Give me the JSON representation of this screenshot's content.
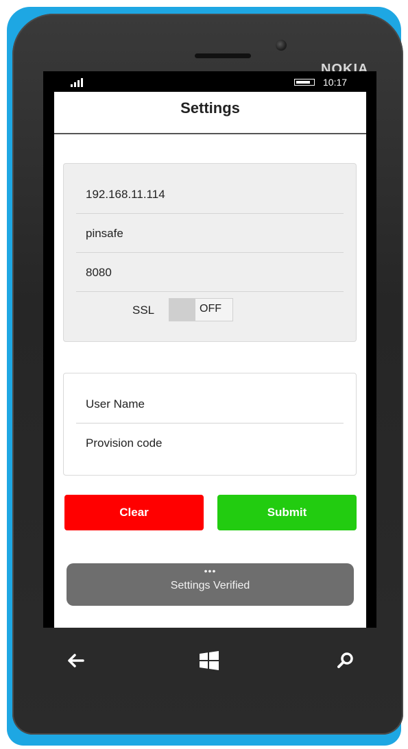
{
  "device": {
    "brand": "NOKIA"
  },
  "status_bar": {
    "time": "10:17",
    "signal_icon": "signal-bars-icon",
    "battery_icon": "battery-icon"
  },
  "header": {
    "title": "Settings"
  },
  "server_settings": {
    "host": "192.168.11.114",
    "site": "pinsafe",
    "port": "8080",
    "ssl_label": "SSL",
    "ssl_state": "OFF"
  },
  "credentials": {
    "username_placeholder": "User Name",
    "provision_placeholder": "Provision code"
  },
  "actions": {
    "clear_label": "Clear",
    "submit_label": "Submit"
  },
  "toast": {
    "dots": "•••",
    "message": "Settings Verified"
  },
  "nav": {
    "back_icon": "back-arrow-icon",
    "home_icon": "windows-start-icon",
    "search_icon": "search-icon"
  },
  "colors": {
    "shell": "#1ea7e3",
    "clear": "#ff0000",
    "submit": "#22cc10",
    "toast": "#6e6e6e"
  }
}
